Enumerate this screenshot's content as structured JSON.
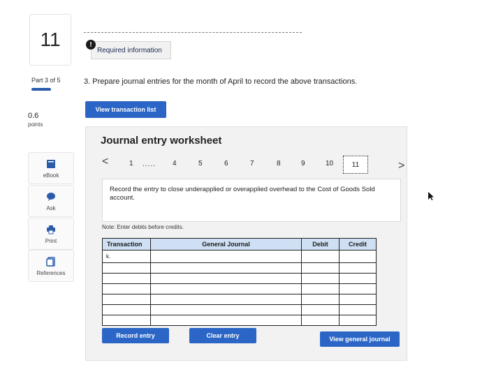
{
  "question": {
    "number": "11"
  },
  "progress": {
    "part_label": "Part 3 of 5",
    "points_value": "0.6",
    "points_label": "points"
  },
  "tools": [
    {
      "label": "eBook"
    },
    {
      "label": "Ask"
    },
    {
      "label": "Print"
    },
    {
      "label": "References"
    }
  ],
  "header": {
    "required_info": "Required information"
  },
  "instruction": "3. Prepare journal entries for the month of April to record the above transactions.",
  "buttons": {
    "view_transactions": "View transaction list",
    "record_entry": "Record entry",
    "clear_entry": "Clear entry",
    "view_general_journal": "View general journal"
  },
  "worksheet": {
    "title": "Journal entry worksheet",
    "nav": {
      "prev": "<",
      "next": ">",
      "dots": ".....",
      "steps": [
        "1",
        "4",
        "5",
        "6",
        "7",
        "8",
        "9",
        "10",
        "11"
      ],
      "current": "11"
    },
    "description": "Record the entry to close underapplied or overapplied overhead to the Cost of Goods Sold account.",
    "note": "Note: Enter debits before credits."
  },
  "table": {
    "headers": {
      "transaction": "Transaction",
      "general_journal": "General Journal",
      "debit": "Debit",
      "credit": "Credit"
    },
    "rows": [
      {
        "transaction": "k.",
        "account": "",
        "debit": "",
        "credit": ""
      },
      {
        "transaction": "",
        "account": "",
        "debit": "",
        "credit": ""
      },
      {
        "transaction": "",
        "account": "",
        "debit": "",
        "credit": ""
      },
      {
        "transaction": "",
        "account": "",
        "debit": "",
        "credit": ""
      },
      {
        "transaction": "",
        "account": "",
        "debit": "",
        "credit": ""
      },
      {
        "transaction": "",
        "account": "",
        "debit": "",
        "credit": ""
      },
      {
        "transaction": "",
        "account": "",
        "debit": "",
        "credit": ""
      }
    ]
  },
  "colors": {
    "accent": "#2b66c6",
    "header_bg": "#cfe0f4",
    "panel_bg": "#f2f2f2"
  }
}
